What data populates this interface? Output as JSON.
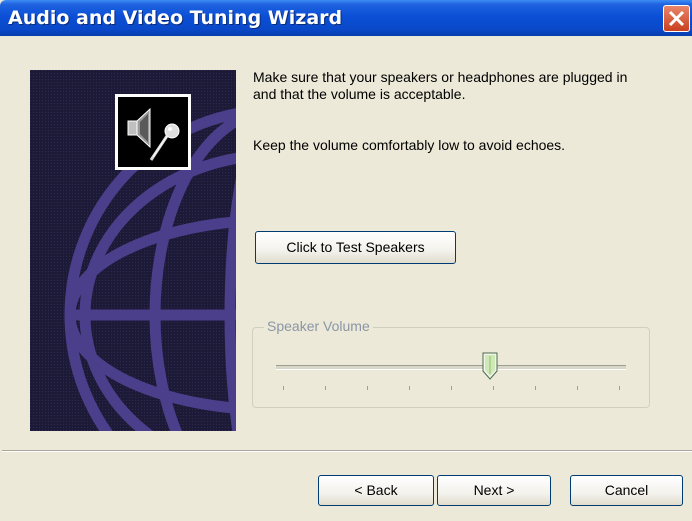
{
  "window": {
    "title": "Audio and Video Tuning Wizard"
  },
  "content": {
    "message_line1": "Make sure that your speakers or headphones are plugged in and that the volume is acceptable.",
    "message_line2": "Keep the volume comfortably low to avoid echoes.",
    "test_button_label": "Click to Test Speakers"
  },
  "volume": {
    "group_label": "Speaker Volume",
    "level_fraction": 0.615,
    "tick_count": 9
  },
  "footer": {
    "back_label": "< Back",
    "next_label": "Next >",
    "cancel_label": "Cancel"
  },
  "icons": {
    "art_icon": "speaker-microphone-icon",
    "close": "close-icon"
  },
  "colors": {
    "titlebar": "#0b4fd6",
    "dialog_bg": "#ece9d8",
    "art_bg": "#1d1a38",
    "globe_lines": "#4b3f8c"
  }
}
